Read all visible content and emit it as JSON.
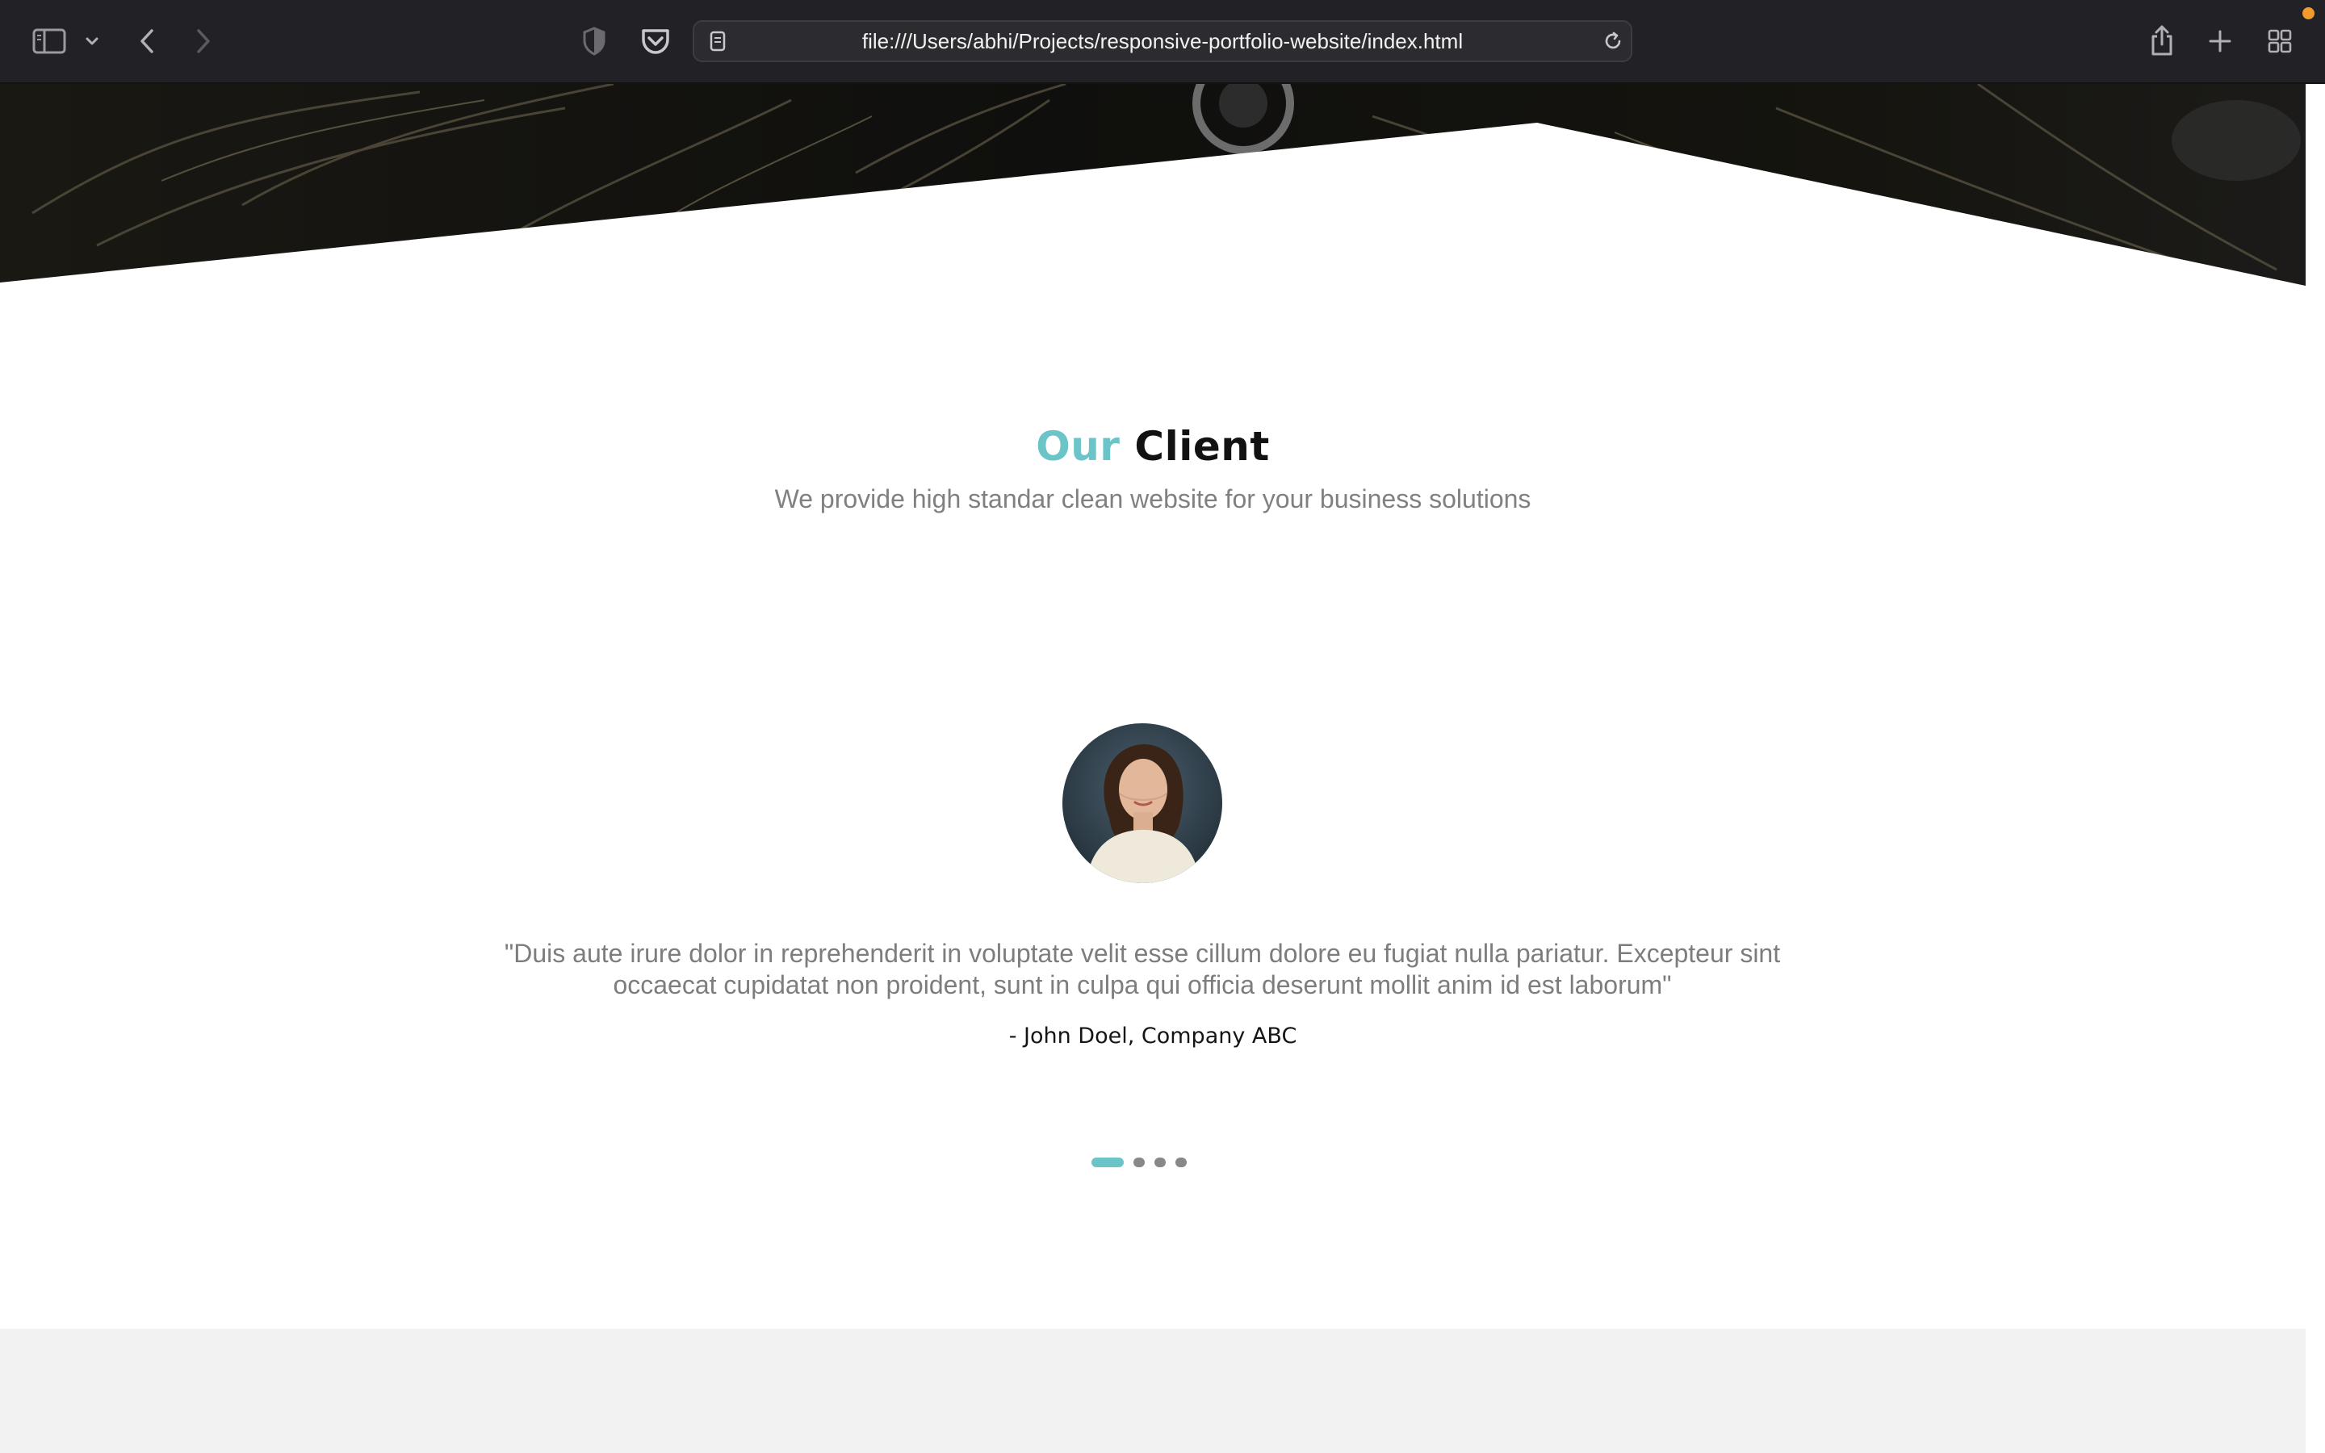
{
  "browser": {
    "url": "file:///Users/abhi/Projects/responsive-portfolio-website/index.html",
    "icons": {
      "sidebar": "sidebar-icon",
      "sidebar_menu": "chevron-down-icon",
      "back": "back-arrow-icon",
      "forward": "forward-arrow-icon",
      "privacy": "shield-icon",
      "pocket": "pocket-icon",
      "reader": "reader-mode-icon",
      "reload": "reload-icon",
      "share": "share-icon",
      "new_tab": "plus-icon",
      "tab_overview": "tab-grid-icon"
    },
    "forward_enabled": false,
    "notification_color": "#f29b2c"
  },
  "client_section": {
    "title_accent": "Our",
    "title_main": "Client",
    "subtitle": "We provide high standar clean website for your business solutions",
    "testimonial": {
      "quote": "\"Duis aute irure dolor in reprehenderit in voluptate velit esse cillum dolore eu fugiat nulla pariatur. Excepteur sint occaecat cupidatat non proident, sunt in culpa qui officia deserunt mollit anim id est laborum\"",
      "author": "- John Doel, Company ABC"
    },
    "carousel": {
      "total": 4,
      "active_index": 0
    }
  },
  "colors": {
    "accent": "#6bc4c8",
    "toolbar_bg": "#222125",
    "heading": "#121212",
    "body_text": "#7d7d7d",
    "footer_bg": "#f2f2f2"
  }
}
